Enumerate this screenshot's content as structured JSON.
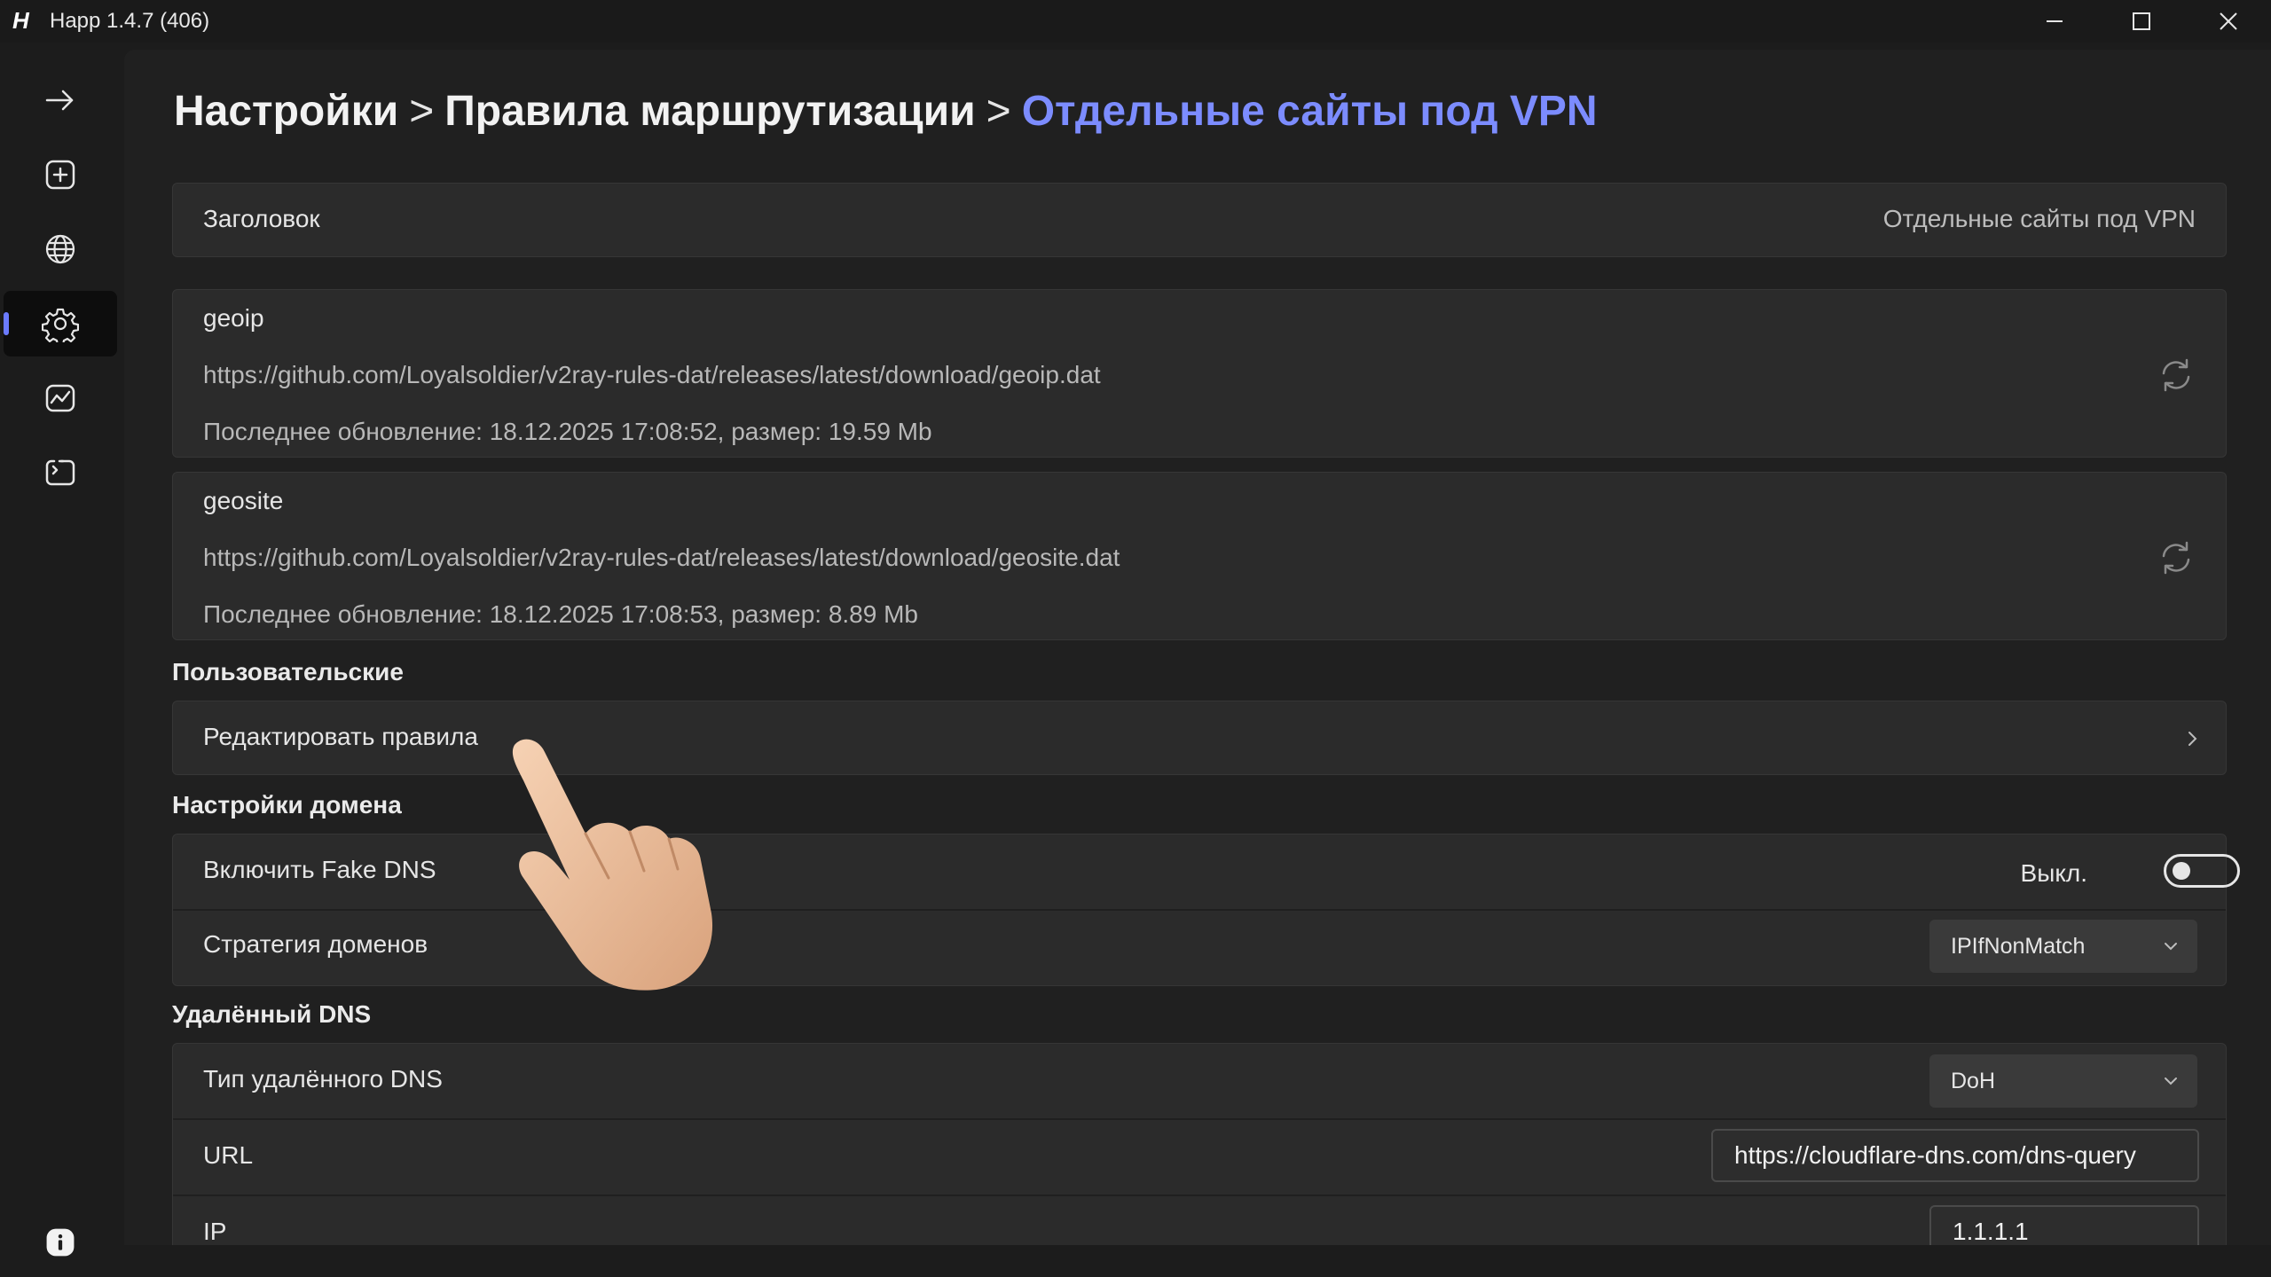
{
  "window": {
    "title": "Happ 1.4.7 (406)",
    "logo_glyph": "H",
    "controls": [
      "minimize-icon",
      "maximize-icon",
      "close-icon"
    ]
  },
  "sidebar": {
    "items": [
      {
        "name": "arrow-right-icon",
        "active": false
      },
      {
        "name": "add-icon",
        "active": false
      },
      {
        "name": "globe-icon",
        "active": false
      },
      {
        "name": "gear-icon",
        "active": true
      },
      {
        "name": "chart-icon",
        "active": false
      },
      {
        "name": "log-icon",
        "active": false
      }
    ],
    "footer_icon": "info-icon"
  },
  "breadcrumb": {
    "part1": "Настройки",
    "sep1": ">",
    "part2": "Правила маршрутизации",
    "sep2": ">",
    "current": "Отдельные сайты под VPN"
  },
  "header_row": {
    "label": "Заголовок",
    "value": "Отдельные сайты под VPN"
  },
  "geoip": {
    "name": "geoip",
    "url": "https://github.com/Loyalsoldier/v2ray-rules-dat/releases/latest/download/geoip.dat",
    "status": "Последнее обновление: 18.12.2025 17:08:52, размер: 19.59 Mb"
  },
  "geosite": {
    "name": "geosite",
    "url": "https://github.com/Loyalsoldier/v2ray-rules-dat/releases/latest/download/geosite.dat",
    "status": "Последнее обновление: 18.12.2025 17:08:53, размер: 8.89 Mb"
  },
  "custom": {
    "section_title": "Пользовательские",
    "edit_rules_label": "Редактировать правила"
  },
  "domain_settings": {
    "section_title": "Настройки домена",
    "fake_dns_label": "Включить Fake DNS",
    "fake_dns_state": "Выкл.",
    "strategy_label": "Стратегия доменов",
    "strategy_value": "IPIfNonMatch"
  },
  "remote_dns": {
    "section_title": "Удалённый DNS",
    "type_label": "Тип удалённого DNS",
    "type_value": "DoH",
    "url_label": "URL",
    "url_value": "https://cloudflare-dns.com/dns-query",
    "ip_label": "IP",
    "ip_value": "1.1.1.1"
  },
  "colors": {
    "accent": "#7c8cff",
    "background": "#1c1c1c",
    "card": "#2b2b2b"
  }
}
